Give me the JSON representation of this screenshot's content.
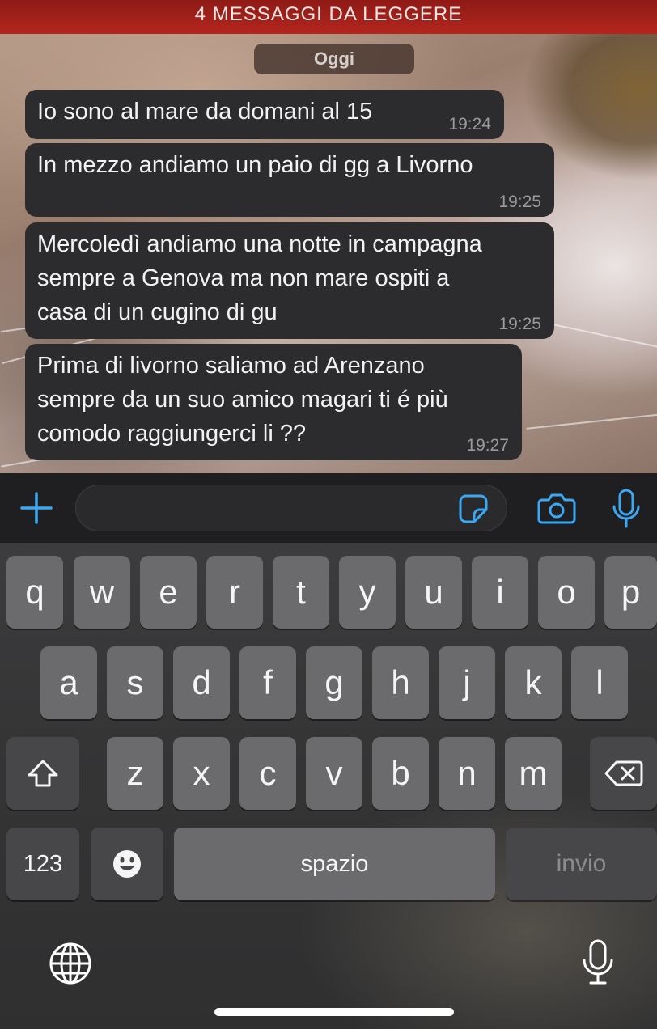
{
  "banner": {
    "text": "4 MESSAGGI DA LEGGERE"
  },
  "chat": {
    "date_label": "Oggi",
    "messages": [
      {
        "text": "Io sono al mare da domani al 15",
        "time": "19:24"
      },
      {
        "text": "In mezzo andiamo un paio di gg a Livorno",
        "time": "19:25"
      },
      {
        "text": "Mercoledì andiamo una notte in campagna\nsempre a Genova ma non mare ospiti a\ncasa di un cugino di gu",
        "time": "19:25"
      },
      {
        "text": "Prima di livorno saliamo ad Arenzano\nsempre da un suo amico magari ti é più\ncomodo raggiungerci li ??",
        "time": "19:27"
      }
    ]
  },
  "input_bar": {
    "message_value": "",
    "icons": [
      "plus-icon",
      "sticker-icon",
      "camera-icon",
      "microphone-icon"
    ],
    "accent_color": "#3aa8f2"
  },
  "keyboard": {
    "row1": [
      "q",
      "w",
      "e",
      "r",
      "t",
      "y",
      "u",
      "i",
      "o",
      "p"
    ],
    "row2": [
      "a",
      "s",
      "d",
      "f",
      "g",
      "h",
      "j",
      "k",
      "l"
    ],
    "row3": [
      "z",
      "x",
      "c",
      "v",
      "b",
      "n",
      "m"
    ],
    "numbers_label": "123",
    "space_label": "spazio",
    "return_label": "invio",
    "icons": [
      "shift-icon",
      "backspace-icon",
      "emoji-icon",
      "globe-icon",
      "dictation-icon"
    ]
  }
}
